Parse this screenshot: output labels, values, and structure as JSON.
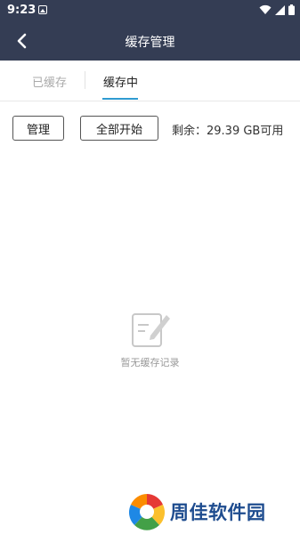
{
  "status_bar": {
    "time": "9:23"
  },
  "header": {
    "title": "缓存管理"
  },
  "tabs": [
    {
      "label": "已缓存"
    },
    {
      "label": "缓存中"
    }
  ],
  "toolbar": {
    "manage_label": "管理",
    "start_all_label": "全部开始",
    "storage_label": "剩余：29.39 GB可用"
  },
  "empty_state": {
    "message": "暂无缓存记录"
  },
  "watermark": {
    "text": "周佳软件园"
  },
  "colors": {
    "header_bg": "#343d54",
    "accent": "#2f9bd1",
    "watermark_text": "#1e4c8f"
  }
}
